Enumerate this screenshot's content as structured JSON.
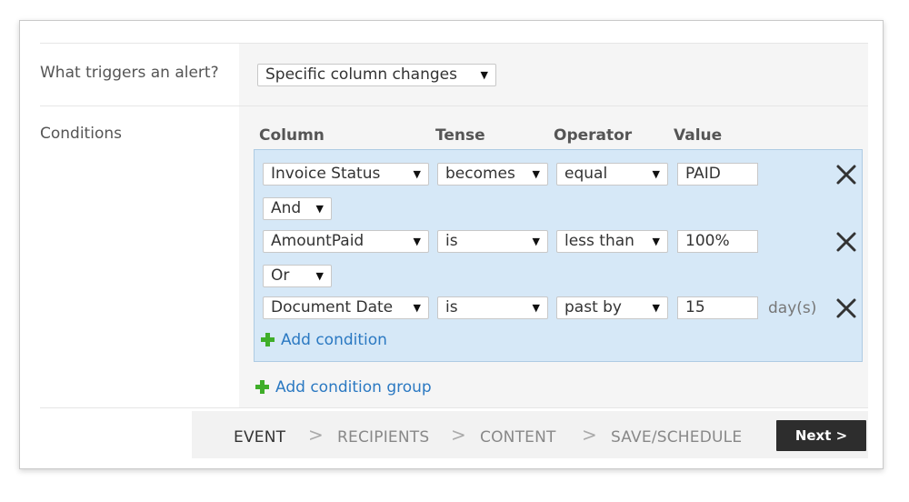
{
  "trigger": {
    "label": "What triggers an alert?",
    "selected": "Specific column changes"
  },
  "conditions": {
    "label": "Conditions",
    "headers": {
      "column": "Column",
      "tense": "Tense",
      "operator": "Operator",
      "value": "Value"
    },
    "rows": [
      {
        "column": "Invoice Status",
        "tense": "becomes",
        "operator": "equal",
        "value": "PAID",
        "unit": ""
      },
      {
        "column": "AmountPaid",
        "tense": "is",
        "operator": "less than",
        "value": "100%",
        "unit": ""
      },
      {
        "column": "Document Date",
        "tense": "is",
        "operator": "past by",
        "value": "15",
        "unit": "day(s)"
      }
    ],
    "connectors": [
      "And",
      "Or"
    ],
    "add_condition": "Add condition",
    "add_condition_group": "Add condition group"
  },
  "wizard": {
    "steps": [
      "EVENT",
      "RECIPIENTS",
      "CONTENT",
      "SAVE/SCHEDULE"
    ],
    "active_step": "EVENT",
    "separator": ">",
    "next_label": "Next >"
  },
  "icons": {
    "dropdown": "triangle-down-icon",
    "remove": "close-icon",
    "add": "plus-icon"
  },
  "colors": {
    "group_bg": "#d6e8f7",
    "link": "#2b79c2",
    "plus": "#3fae29",
    "next_bg": "#2d2d2d"
  }
}
